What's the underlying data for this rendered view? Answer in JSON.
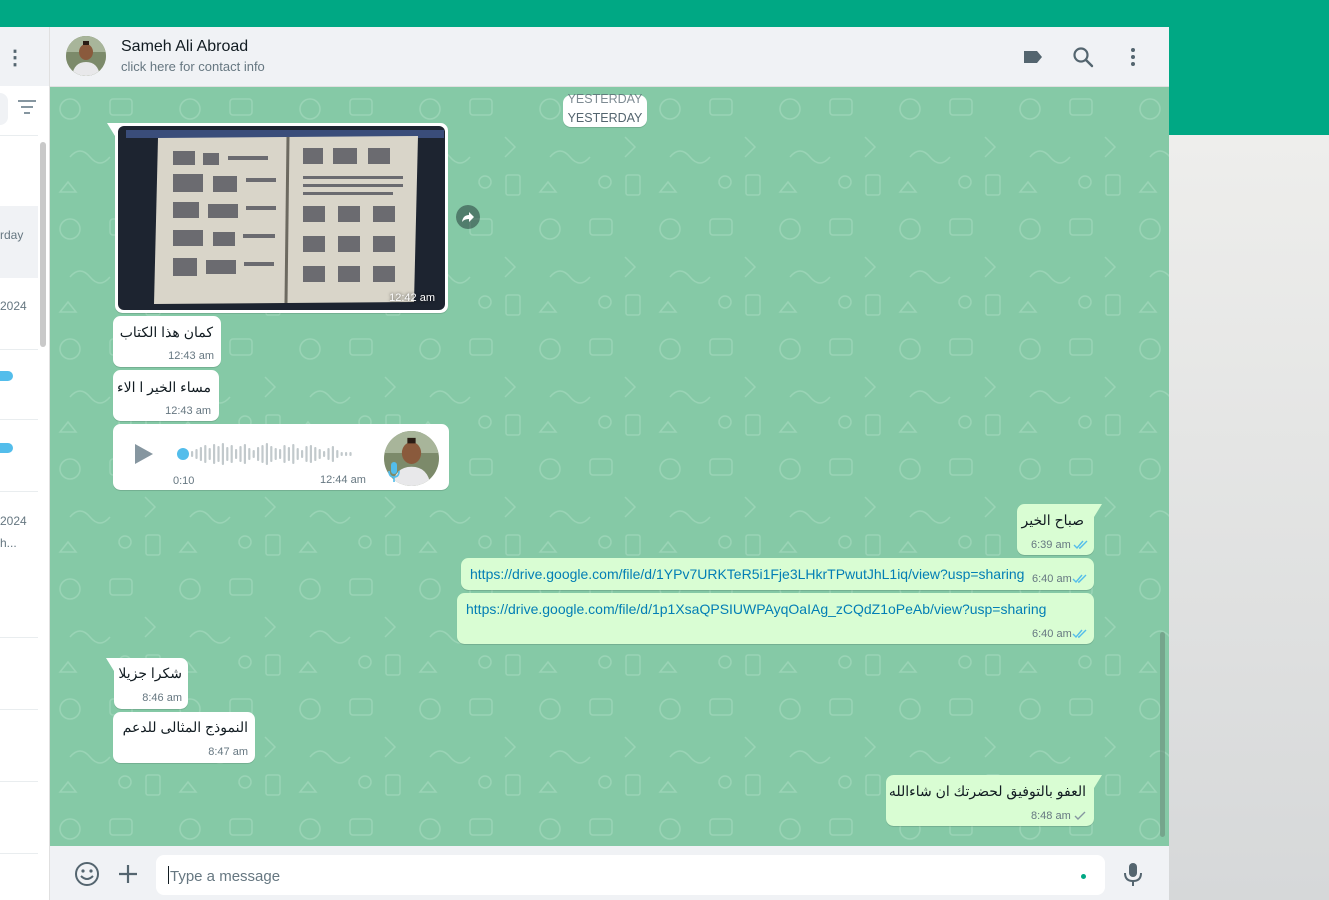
{
  "colors": {
    "accent": "#00a884",
    "incoming": "#ffffff",
    "outgoing": "#d9fdd3",
    "chat_bg": "#85c9a6",
    "link": "#027eb5",
    "read_ticks": "#53bdeb"
  },
  "sidebar": {
    "menu_icon": "dots-vertical-icon",
    "filter_icon": "filter-icon",
    "items": [
      {
        "label": "rday"
      },
      {
        "label": "2024"
      },
      {
        "label": "2024"
      },
      {
        "label": "h..."
      }
    ]
  },
  "header": {
    "contact_name": "Sameh Ali Abroad",
    "contact_sub": "click here for contact info",
    "icons": [
      "label-icon",
      "search-icon",
      "dots-vertical-icon"
    ]
  },
  "messages": {
    "date_chip": "YESTERDAY",
    "image": {
      "time": "12:42 am"
    },
    "m1": {
      "text": "كمان هذا الكتاب",
      "time": "12:43 am"
    },
    "m2": {
      "text": "مساء الخير ا الاء",
      "time": "12:43 am"
    },
    "voice": {
      "duration": "0:10",
      "time": "12:44 am"
    },
    "m3": {
      "text": "صباح الخير",
      "time": "6:39 am"
    },
    "m4": {
      "text": "https://drive.google.com/file/d/1YPv7URKTeR5i1Fje3LHkrTPwutJhL1iq/view?usp=sharing",
      "time": "6:40 am"
    },
    "m5": {
      "text": "https://drive.google.com/file/d/1p1XsaQPSIUWPAyqOaIAg_zCQdZ1oPeAb/view?usp=sharing",
      "time": "6:40 am"
    },
    "m6": {
      "text": "شكرا جزيلا",
      "time": "8:46 am"
    },
    "m7": {
      "text": "النموذج المثالى للدعم",
      "time": "8:47 am"
    },
    "m8": {
      "text": "العفو بالتوفيق لحضرتك ان شاءالله",
      "time": "8:48 am"
    }
  },
  "footer": {
    "placeholder": "Type a message",
    "icons": [
      "emoji-icon",
      "plus-icon",
      "microphone-icon"
    ]
  }
}
